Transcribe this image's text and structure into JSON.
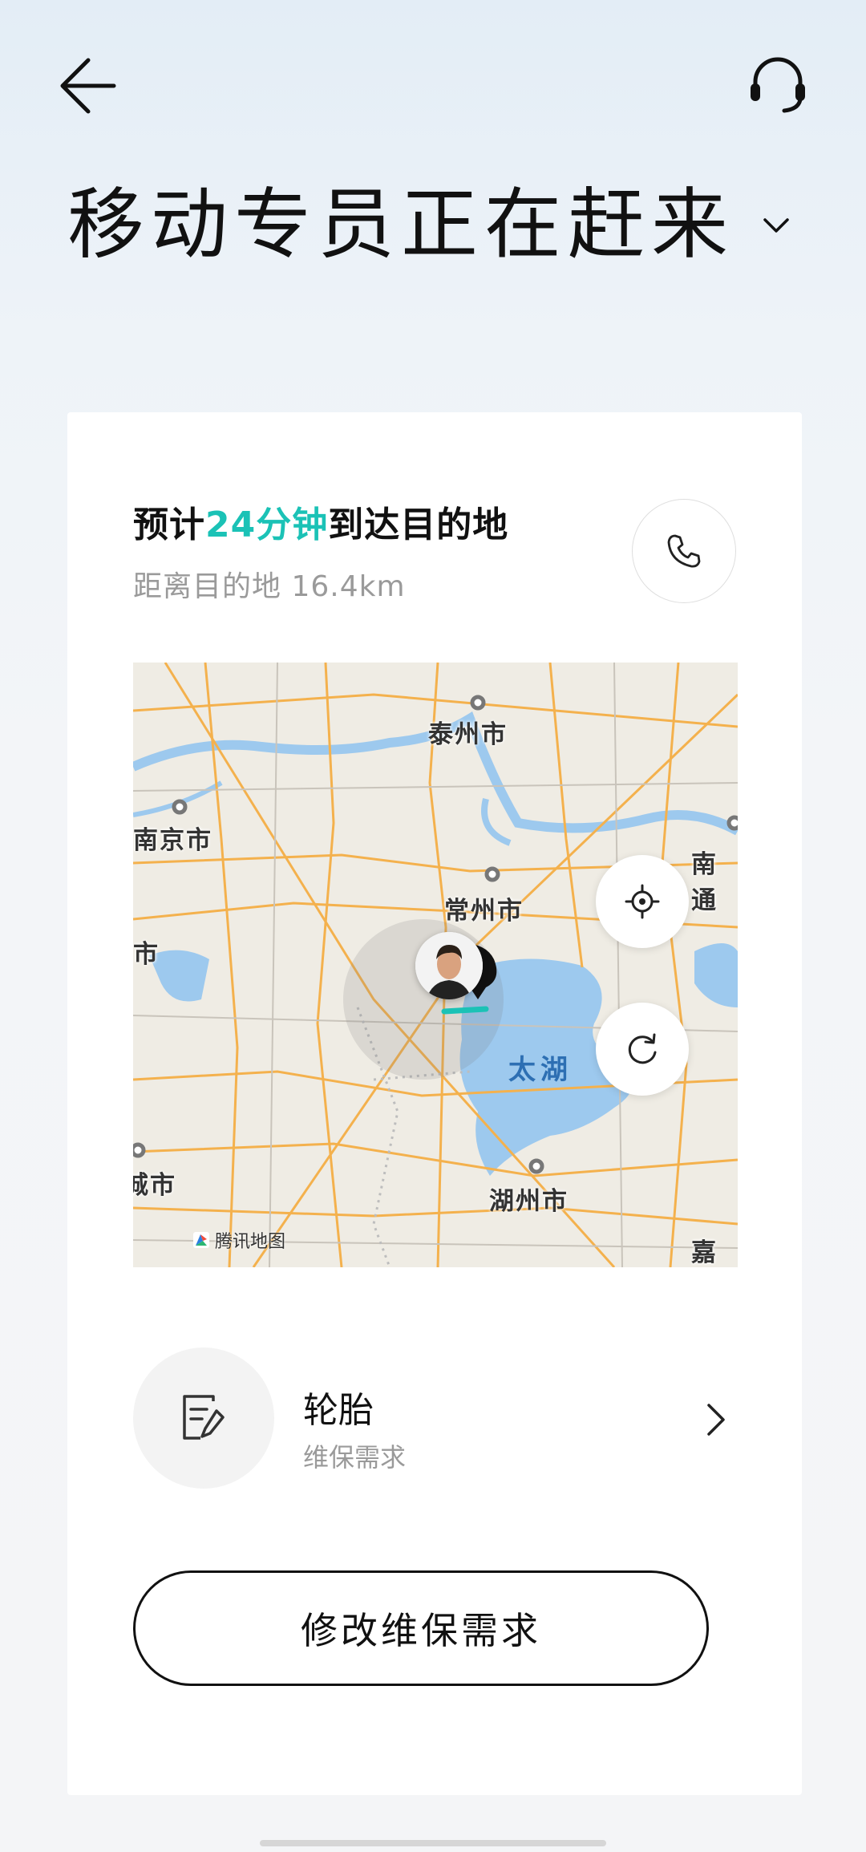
{
  "header": {
    "title": "移动专员正在赶来"
  },
  "eta": {
    "prefix": "预计",
    "minutes": "24分钟",
    "suffix": "到达目的地",
    "distance": "距离目的地 16.4km"
  },
  "map": {
    "provider": "腾讯地图",
    "cities": [
      "泰州市",
      "南京市",
      "常州市",
      "湖州市",
      "南通",
      "嘉兴",
      "市",
      "城市"
    ],
    "lake": "太湖"
  },
  "service": {
    "name": "轮胎",
    "category": "维保需求"
  },
  "actions": {
    "modify_label": "修改维保需求"
  },
  "colors": {
    "accent": "#1bc2b6",
    "road": "#f4b14d",
    "water": "#9dc9ee"
  },
  "icons": [
    "back-arrow-icon",
    "headset-icon",
    "chevron-down-icon",
    "phone-icon",
    "locate-icon",
    "refresh-icon",
    "edit-note-icon",
    "chevron-right-icon"
  ]
}
